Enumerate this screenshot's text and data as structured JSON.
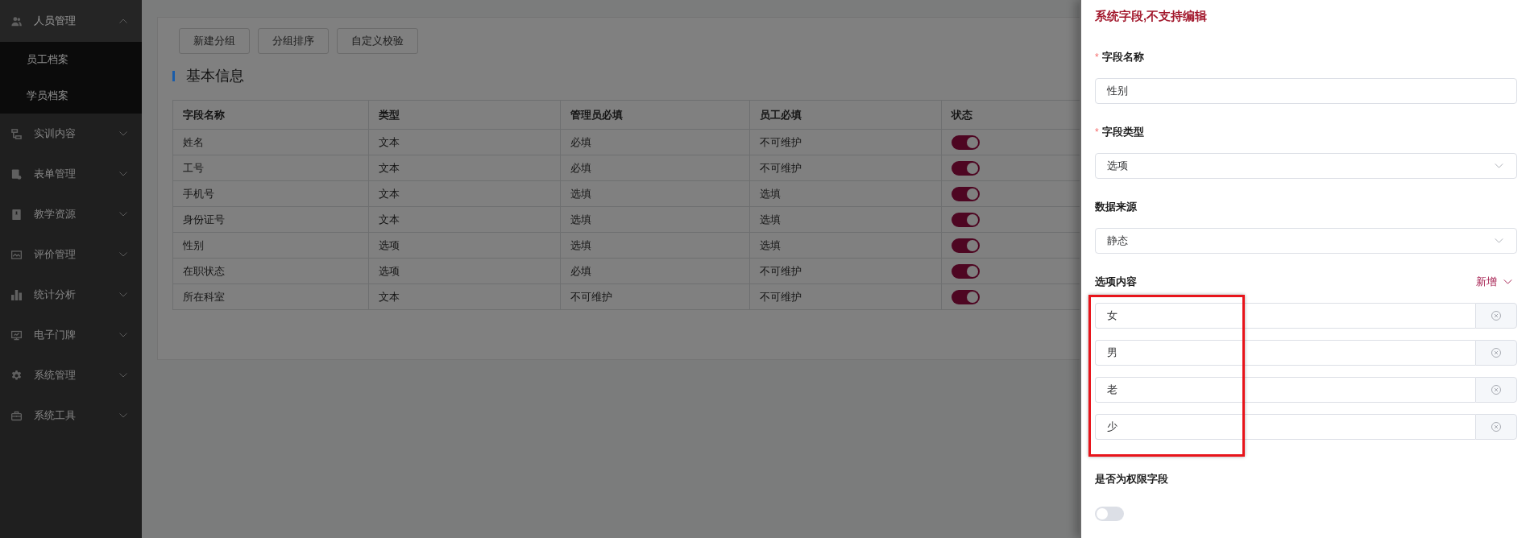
{
  "sidebar": {
    "items": [
      {
        "label": "人员管理",
        "expanded": true,
        "children": [
          {
            "label": "员工档案"
          },
          {
            "label": "学员档案"
          }
        ]
      },
      {
        "label": "实训内容",
        "expanded": false
      },
      {
        "label": "表单管理",
        "expanded": false
      },
      {
        "label": "教学资源",
        "expanded": false
      },
      {
        "label": "评价管理",
        "expanded": false
      },
      {
        "label": "统计分析",
        "expanded": false
      },
      {
        "label": "电子门牌",
        "expanded": false
      },
      {
        "label": "系统管理",
        "expanded": false
      },
      {
        "label": "系统工具",
        "expanded": false
      }
    ]
  },
  "toolbar": {
    "buttons": [
      "新建分组",
      "分组排序",
      "自定义校验"
    ]
  },
  "section": {
    "title": "基本信息"
  },
  "table": {
    "columns": [
      "字段名称",
      "类型",
      "管理员必填",
      "员工必填",
      "状态"
    ],
    "rows": [
      {
        "cells": [
          "姓名",
          "文本",
          "必填",
          "不可维护"
        ],
        "on": true
      },
      {
        "cells": [
          "工号",
          "文本",
          "必填",
          "不可维护"
        ],
        "on": true
      },
      {
        "cells": [
          "手机号",
          "文本",
          "选填",
          "选填"
        ],
        "on": true
      },
      {
        "cells": [
          "身份证号",
          "文本",
          "选填",
          "选填"
        ],
        "on": true
      },
      {
        "cells": [
          "性别",
          "选项",
          "选填",
          "选填"
        ],
        "on": true
      },
      {
        "cells": [
          "在职状态",
          "选项",
          "必填",
          "不可维护"
        ],
        "on": true
      },
      {
        "cells": [
          "所在科室",
          "文本",
          "不可维护",
          "不可维护"
        ],
        "on": true
      }
    ]
  },
  "drawer": {
    "notice": "系统字段,不支持编辑",
    "fields": [
      {
        "kind": "input",
        "required_mark": "*",
        "label": "字段名称",
        "value": "性别"
      },
      {
        "kind": "select",
        "required_mark": "*",
        "label": "字段类型",
        "value": "选项"
      },
      {
        "kind": "select",
        "label": "数据来源",
        "value": "静态"
      },
      {
        "kind": "options",
        "label": "选项内容",
        "action": "新增",
        "highlighted": true,
        "options": [
          "女",
          "男",
          "老",
          "少"
        ]
      },
      {
        "kind": "switch",
        "label": "是否为权限字段",
        "on": false
      }
    ]
  }
}
